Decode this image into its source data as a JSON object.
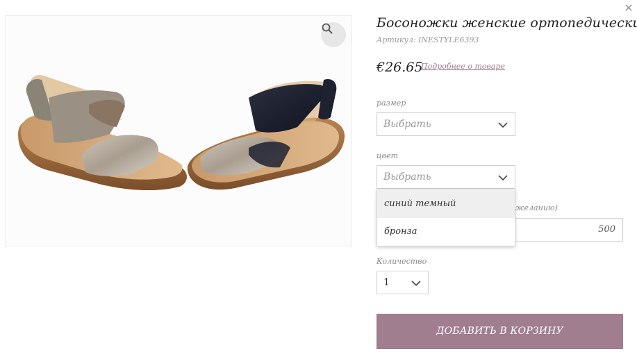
{
  "close_icon": "close-icon",
  "product": {
    "title": "Босоножки женские ортопедические",
    "sku_label": "Артикул:",
    "sku_value": "INESTYLE6393",
    "price": "€26.65",
    "details_link": "Подробнее о товаре"
  },
  "image": {
    "zoom_icon": "magnifier-icon"
  },
  "size_field": {
    "label": "размер",
    "value": "Выбрать"
  },
  "color_field": {
    "label": "цвет",
    "value": "Выбрать",
    "options": [
      "синий темный",
      "бронза"
    ]
  },
  "custom_field": {
    "label_partial": "желанию)",
    "value": "500"
  },
  "quantity": {
    "label": "Количество",
    "value": "1"
  },
  "add_to_cart": "ДОБАВИТЬ В КОРЗИНУ",
  "colors": {
    "accent": "#a07d8f",
    "link": "#a07a8d"
  }
}
